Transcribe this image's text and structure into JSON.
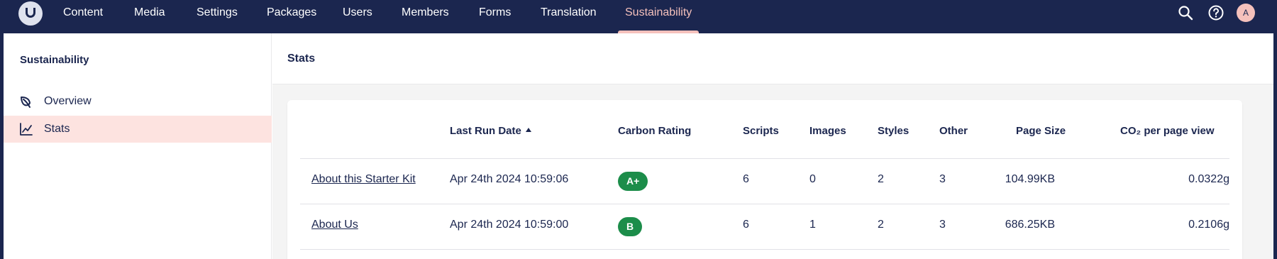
{
  "topbar": {
    "nav": [
      {
        "label": "Content",
        "active": false
      },
      {
        "label": "Media",
        "active": false
      },
      {
        "label": "Settings",
        "active": false
      },
      {
        "label": "Packages",
        "active": false
      },
      {
        "label": "Users",
        "active": false
      },
      {
        "label": "Members",
        "active": false
      },
      {
        "label": "Forms",
        "active": false
      },
      {
        "label": "Translation",
        "active": false
      },
      {
        "label": "Sustainability",
        "active": true
      }
    ],
    "icons": [
      "search-icon",
      "help-icon"
    ],
    "avatar_initial": "A"
  },
  "sidebar": {
    "title": "Sustainability",
    "items": [
      {
        "label": "Overview",
        "icon": "leaf-icon",
        "active": false
      },
      {
        "label": "Stats",
        "icon": "chart-line-icon",
        "active": true
      }
    ]
  },
  "main": {
    "title": "Stats",
    "table": {
      "columns": [
        "",
        "Last Run Date",
        "Carbon Rating",
        "Scripts",
        "Images",
        "Styles",
        "Other",
        "Page Size",
        "CO₂ per page view"
      ],
      "sorted_column": "Last Run Date",
      "sort_direction": "ascending",
      "rows": [
        {
          "page": "About this Starter Kit",
          "last_run": "Apr 24th 2024 10:59:06",
          "rating": "A+",
          "scripts": "6",
          "images": "0",
          "styles": "2",
          "other": "3",
          "page_size": "104.99KB",
          "co2": "0.0322g"
        },
        {
          "page": "About Us",
          "last_run": "Apr 24th 2024 10:59:00",
          "rating": "B",
          "scripts": "6",
          "images": "1",
          "styles": "2",
          "other": "3",
          "page_size": "686.25KB",
          "co2": "0.2106g"
        }
      ]
    }
  },
  "colors": {
    "header_bg": "#1b264f",
    "accent": "#f5c1bc",
    "active_item_bg": "#fde3e0",
    "rating_badge": "#1c8d4a"
  }
}
